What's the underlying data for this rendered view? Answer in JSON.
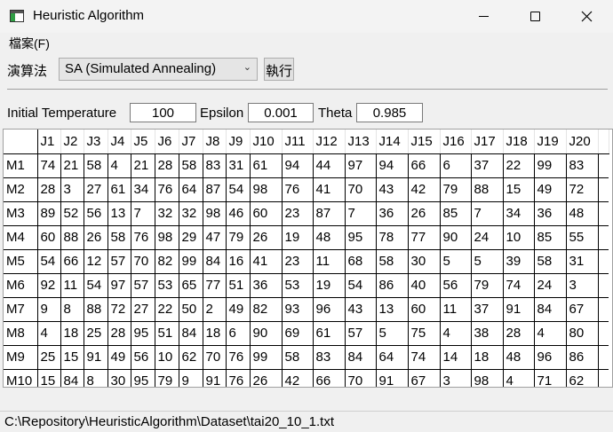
{
  "window": {
    "title": "Heuristic Algorithm"
  },
  "menu": {
    "file_label": "檔案(F)"
  },
  "toolbar": {
    "algorithm_label": "演算法",
    "algorithm_selected": "SA (Simulated Annealing)",
    "run_label": "執行"
  },
  "params": {
    "initial_temperature_label": "Initial Temperature",
    "initial_temperature_value": "100",
    "epsilon_label": "Epsilon",
    "epsilon_value": "0.001",
    "theta_label": "Theta",
    "theta_value": "0.985"
  },
  "grid": {
    "columns": [
      "J1",
      "J2",
      "J3",
      "J4",
      "J5",
      "J6",
      "J7",
      "J8",
      "J9",
      "J10",
      "J11",
      "J12",
      "J13",
      "J14",
      "J15",
      "J16",
      "J17",
      "J18",
      "J19",
      "J20"
    ],
    "rows": [
      {
        "label": "M1",
        "values": [
          "74",
          "21",
          "58",
          "4",
          "21",
          "28",
          "58",
          "83",
          "31",
          "61",
          "94",
          "44",
          "97",
          "94",
          "66",
          "6",
          "37",
          "22",
          "99",
          "83"
        ]
      },
      {
        "label": "M2",
        "values": [
          "28",
          "3",
          "27",
          "61",
          "34",
          "76",
          "64",
          "87",
          "54",
          "98",
          "76",
          "41",
          "70",
          "43",
          "42",
          "79",
          "88",
          "15",
          "49",
          "72"
        ]
      },
      {
        "label": "M3",
        "values": [
          "89",
          "52",
          "56",
          "13",
          "7",
          "32",
          "32",
          "98",
          "46",
          "60",
          "23",
          "87",
          "7",
          "36",
          "26",
          "85",
          "7",
          "34",
          "36",
          "48"
        ]
      },
      {
        "label": "M4",
        "values": [
          "60",
          "88",
          "26",
          "58",
          "76",
          "98",
          "29",
          "47",
          "79",
          "26",
          "19",
          "48",
          "95",
          "78",
          "77",
          "90",
          "24",
          "10",
          "85",
          "55"
        ]
      },
      {
        "label": "M5",
        "values": [
          "54",
          "66",
          "12",
          "57",
          "70",
          "82",
          "99",
          "84",
          "16",
          "41",
          "23",
          "11",
          "68",
          "58",
          "30",
          "5",
          "5",
          "39",
          "58",
          "31"
        ]
      },
      {
        "label": "M6",
        "values": [
          "92",
          "11",
          "54",
          "97",
          "57",
          "53",
          "65",
          "77",
          "51",
          "36",
          "53",
          "19",
          "54",
          "86",
          "40",
          "56",
          "79",
          "74",
          "24",
          "3"
        ]
      },
      {
        "label": "M7",
        "values": [
          "9",
          "8",
          "88",
          "72",
          "27",
          "22",
          "50",
          "2",
          "49",
          "82",
          "93",
          "96",
          "43",
          "13",
          "60",
          "11",
          "37",
          "91",
          "84",
          "67"
        ]
      },
      {
        "label": "M8",
        "values": [
          "4",
          "18",
          "25",
          "28",
          "95",
          "51",
          "84",
          "18",
          "6",
          "90",
          "69",
          "61",
          "57",
          "5",
          "75",
          "4",
          "38",
          "28",
          "4",
          "80"
        ]
      },
      {
        "label": "M9",
        "values": [
          "25",
          "15",
          "91",
          "49",
          "56",
          "10",
          "62",
          "70",
          "76",
          "99",
          "58",
          "83",
          "84",
          "64",
          "74",
          "14",
          "18",
          "48",
          "96",
          "86"
        ]
      },
      {
        "label": "M10",
        "values": [
          "15",
          "84",
          "8",
          "30",
          "95",
          "79",
          "9",
          "91",
          "76",
          "26",
          "42",
          "66",
          "70",
          "91",
          "67",
          "3",
          "98",
          "4",
          "71",
          "62"
        ]
      }
    ]
  },
  "status": {
    "path": "C:\\Repository\\HeuristicAlgorithm\\Dataset\\tai20_10_1.txt"
  }
}
